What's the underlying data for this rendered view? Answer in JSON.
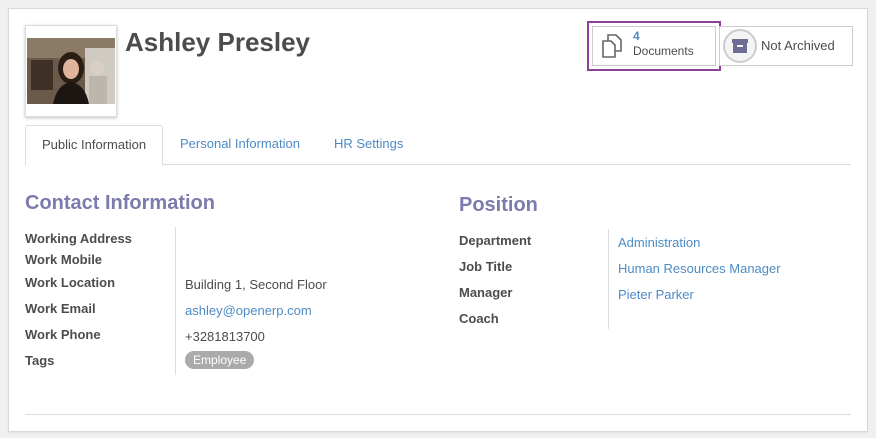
{
  "employee": {
    "name": "Ashley Presley"
  },
  "buttons": {
    "documents_count": "4",
    "documents_label": "Documents",
    "archive_label": "Not Archived"
  },
  "tabs": [
    {
      "label": "Public Information",
      "active": true
    },
    {
      "label": "Personal Information",
      "active": false
    },
    {
      "label": "HR Settings",
      "active": false
    }
  ],
  "contact": {
    "title": "Contact Information",
    "fields": [
      {
        "label": "Working Address",
        "value": ""
      },
      {
        "label": "Work Mobile",
        "value": ""
      },
      {
        "label": "Work Location",
        "value": "Building 1, Second Floor"
      },
      {
        "label": "Work Email",
        "value": "ashley@openerp.com"
      },
      {
        "label": "Work Phone",
        "value": "+3281813700"
      },
      {
        "label": "Tags",
        "value": "Employee"
      }
    ]
  },
  "position": {
    "title": "Position",
    "fields": [
      {
        "label": "Department",
        "value": "Administration"
      },
      {
        "label": "Job Title",
        "value": "Human Resources Manager"
      },
      {
        "label": "Manager",
        "value": "Pieter Parker"
      },
      {
        "label": "Coach",
        "value": ""
      }
    ]
  },
  "colors": {
    "accent": "#7c7bad",
    "link": "#4c8bc4",
    "highlight_border": "#8e3f9c"
  },
  "icons": {
    "documents": "copy-documents-icon",
    "archive": "archive-box-icon"
  }
}
